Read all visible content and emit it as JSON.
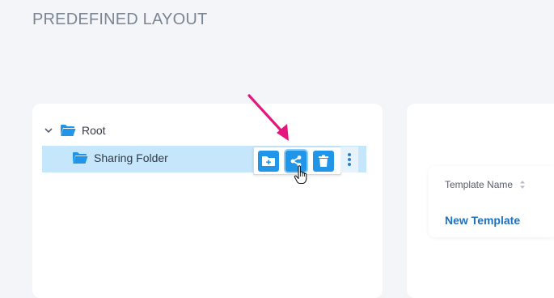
{
  "page": {
    "title": "PREDEFINED LAYOUT"
  },
  "tree": {
    "root_label": "Root",
    "child_label": "Sharing Folder"
  },
  "actions": {
    "add_icon": "folder-add-icon",
    "share_icon": "share-icon",
    "delete_icon": "trash-icon",
    "more_icon": "kebab-menu-icon"
  },
  "table": {
    "column_header": "Template Name",
    "rows": [
      "New Template"
    ]
  },
  "colors": {
    "accent": "#2196e8",
    "selection": "#c5e6fb",
    "annotation_arrow": "#e5177f",
    "link": "#1f6fbf"
  }
}
